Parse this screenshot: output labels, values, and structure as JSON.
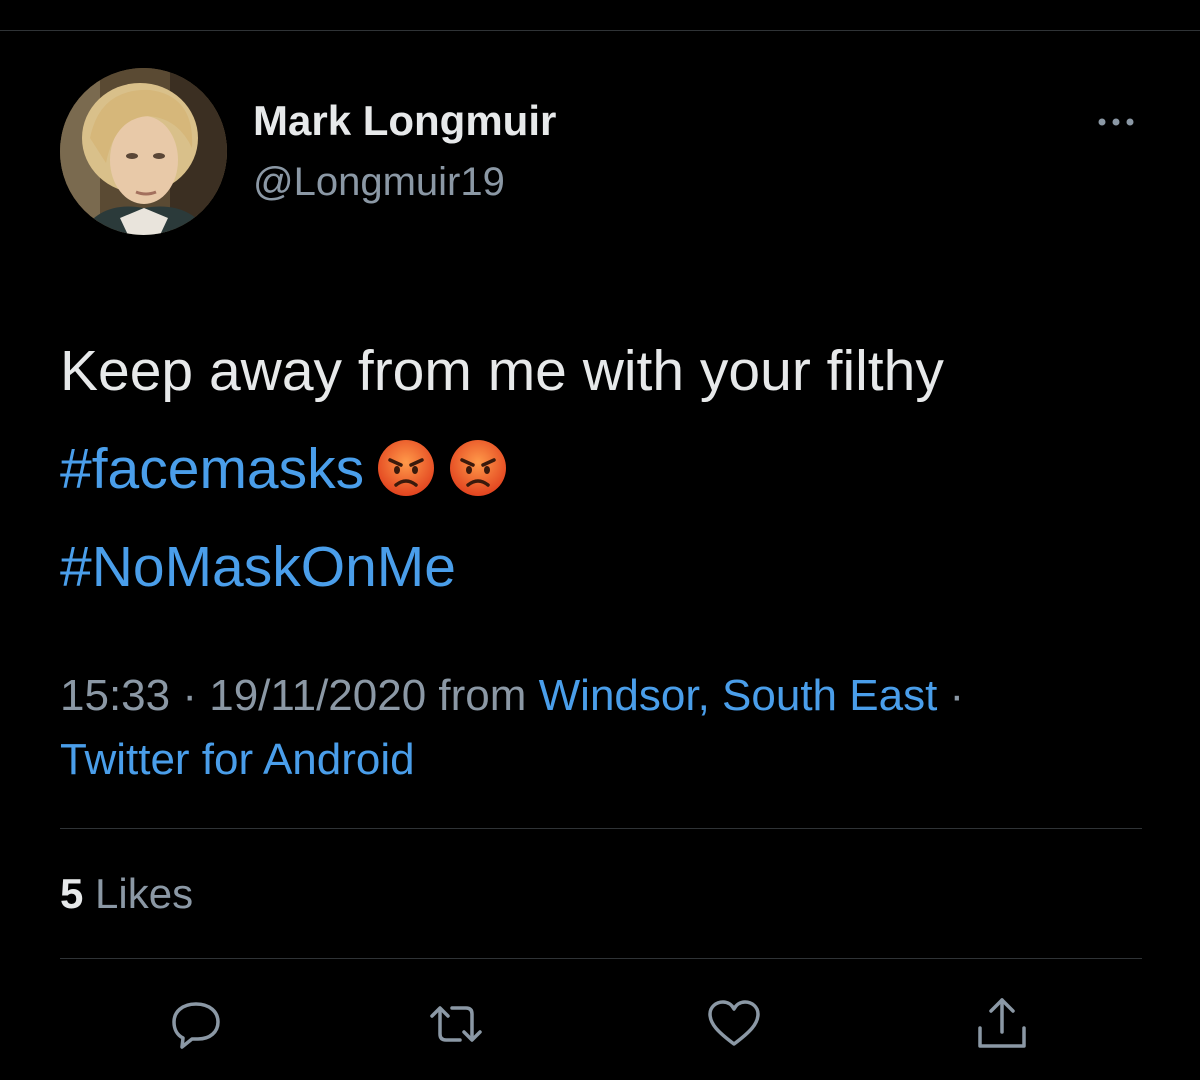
{
  "user": {
    "display_name": "Mark Longmuir",
    "handle": "@Longmuir19",
    "avatar_icon": "profile-photo"
  },
  "tweet": {
    "text_line1": "Keep away from me with your filthy",
    "hashtag1": "#facemasks",
    "emoji": [
      "angry-face",
      "angry-face"
    ],
    "hashtag2": "#NoMaskOnMe"
  },
  "meta": {
    "time": "15:33",
    "date": "19/11/2020",
    "from_label": "from",
    "location": "Windsor, South East",
    "separator": "·",
    "source": "Twitter for Android"
  },
  "stats": {
    "likes_count": "5",
    "likes_label": "Likes"
  },
  "actions": {
    "icons": [
      "reply-icon",
      "retweet-icon",
      "like-icon",
      "share-icon"
    ]
  },
  "colors": {
    "background": "#000000",
    "text_primary": "#e7e9ea",
    "text_secondary": "#8b98a5",
    "link": "#4a9eea",
    "divider": "#2f3336"
  }
}
